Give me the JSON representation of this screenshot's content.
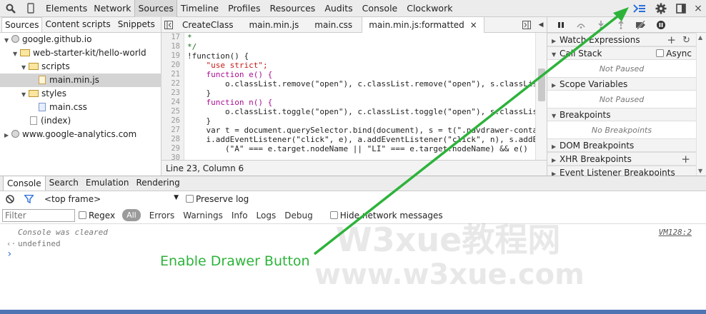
{
  "topbar": {
    "tabs": [
      "Elements",
      "Network",
      "Sources",
      "Timeline",
      "Profiles",
      "Resources",
      "Audits",
      "Console",
      "Clockwork"
    ],
    "active_tab": "Sources"
  },
  "navigator": {
    "tabs": [
      "Sources",
      "Content scripts",
      "Snippets"
    ],
    "tree": [
      {
        "label": "google.github.io",
        "kind": "origin"
      },
      {
        "label": "web-starter-kit/hello-world",
        "kind": "folder"
      },
      {
        "label": "scripts",
        "kind": "folder"
      },
      {
        "label": "main.min.js",
        "kind": "js"
      },
      {
        "label": "styles",
        "kind": "folder"
      },
      {
        "label": "main.css",
        "kind": "css"
      },
      {
        "label": "(index)",
        "kind": "doc"
      },
      {
        "label": "www.google-analytics.com",
        "kind": "origin"
      }
    ]
  },
  "editor": {
    "tabs": [
      "CreateClass",
      "main.min.js",
      "main.css",
      "main.min.js:formatted"
    ],
    "close_symbol": "×",
    "line_numbers": [
      "17",
      "18",
      "19",
      "20",
      "21",
      "22",
      "23",
      "24",
      "25",
      "26",
      "27",
      "28",
      "29",
      "30"
    ],
    "lines": [
      "*",
      "*/",
      "!function() {",
      "    \"use strict\";",
      "    function e() {",
      "        o.classList.remove(\"open\"), c.classList.remove(\"open\"), s.classLis",
      "    }",
      "    function n() {",
      "        o.classList.toggle(\"open\"), c.classList.toggle(\"open\"), s.classLis",
      "    }",
      "    var t = document.querySelector.bind(document), s = t(\".navdrawer-conta",
      "    i.addEventListener(\"click\", e), a.addEventListener(\"click\", n), s.addE",
      "        (\"A\" === e.target.nodeName || \"LI\" === e.target.nodeName) && e()",
      ""
    ],
    "status": "Line 23, Column 6"
  },
  "sidebar": {
    "sections": [
      {
        "title": "Watch Expressions",
        "open": false,
        "body": null
      },
      {
        "title": "Call Stack",
        "open": true,
        "body": "Not Paused",
        "extra": "Async"
      },
      {
        "title": "Scope Variables",
        "open": true,
        "body": "Not Paused"
      },
      {
        "title": "Breakpoints",
        "open": true,
        "body": "No Breakpoints"
      },
      {
        "title": "DOM Breakpoints",
        "open": false,
        "body": null
      },
      {
        "title": "XHR Breakpoints",
        "open": false,
        "body": null
      },
      {
        "title": "Event Listener Breakpoints",
        "open": false,
        "body": null
      }
    ]
  },
  "drawer": {
    "tabs": [
      "Console",
      "Search",
      "Emulation",
      "Rendering"
    ],
    "frame": "<top frame>",
    "preserve_log": "Preserve log",
    "filter_placeholder": "Filter",
    "regex": "Regex",
    "levels": [
      "All",
      "Errors",
      "Warnings",
      "Info",
      "Logs",
      "Debug"
    ],
    "hide_network": "Hide network messages",
    "messages": [
      {
        "text": "Console was cleared",
        "source": "VM128:2"
      },
      {
        "text": "undefined",
        "source": ""
      }
    ],
    "prompt": "›"
  },
  "callout": {
    "text": "Enable Drawer Button",
    "color": "#2db33a"
  },
  "watermark": {
    "line1": "W3xue教程网",
    "line2": "www.w3xue.com"
  }
}
